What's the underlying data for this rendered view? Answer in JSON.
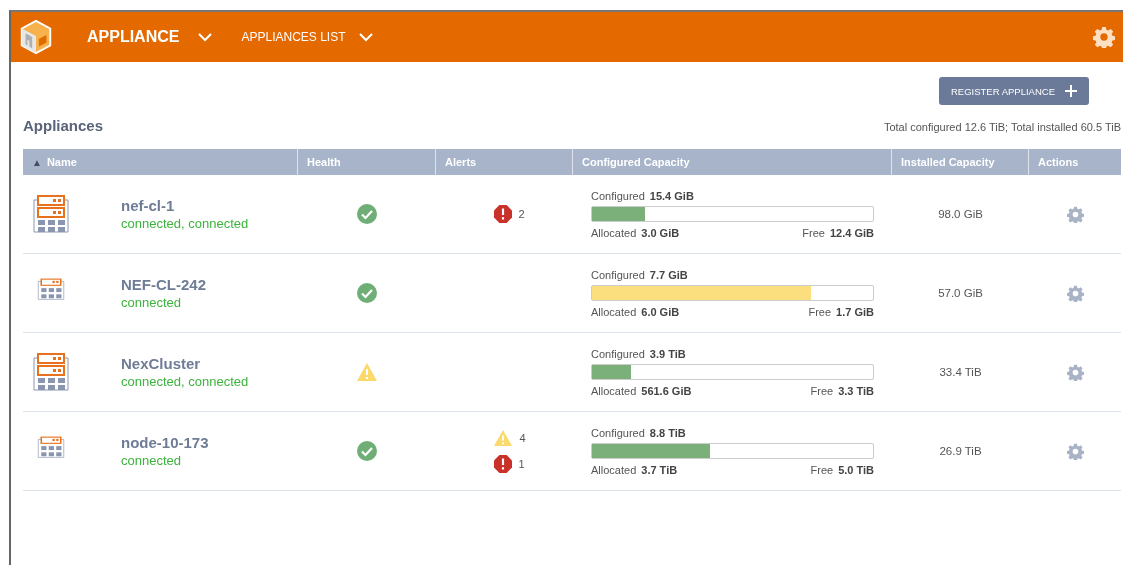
{
  "header": {
    "title": "APPLIANCE",
    "nav": "APPLIANCES LIST"
  },
  "register_button": "REGISTER APPLIANCE",
  "heading": "Appliances",
  "totals": "Total configured 12.6 TiB; Total installed 60.5 TiB",
  "table": {
    "columns": [
      {
        "label": "Name",
        "sort": "▲"
      },
      {
        "label": "Health"
      },
      {
        "label": "Alerts"
      },
      {
        "label": "Configured Capacity"
      },
      {
        "label": "Installed Capacity"
      },
      {
        "label": "Actions"
      }
    ],
    "rows": [
      {
        "kind": "cluster",
        "name": "nef-cl-1",
        "status": "connected, connected",
        "health": {
          "kind": "ok"
        },
        "alerts": [
          {
            "kind": "error",
            "count": "2"
          }
        ],
        "configured_label": "Configured",
        "configured": "15.4 GiB",
        "level": 0.19,
        "color": "#7cb07a",
        "allocated_label": "Allocated",
        "allocated": "3.0 GiB",
        "free_label": "Free",
        "free": "12.4 GiB",
        "installed": "98.0 GiB"
      },
      {
        "kind": "single",
        "name": "NEF-CL-242",
        "status": "connected",
        "health": {
          "kind": "ok"
        },
        "alerts": [],
        "configured_label": "Configured",
        "configured": "7.7 GiB",
        "level": 0.78,
        "color": "#fbdf7e",
        "allocated_label": "Allocated",
        "allocated": "6.0 GiB",
        "free_label": "Free",
        "free": "1.7 GiB",
        "installed": "57.0 GiB"
      },
      {
        "kind": "cluster",
        "name": "NexCluster",
        "status": "connected, connected",
        "health": {
          "kind": "warning"
        },
        "alerts": [],
        "configured_label": "Configured",
        "configured": "3.9 TiB",
        "level": 0.14,
        "color": "#7cb07a",
        "allocated_label": "Allocated",
        "allocated": "561.6 GiB",
        "free_label": "Free",
        "free": "3.3 TiB",
        "installed": "33.4 TiB"
      },
      {
        "kind": "single",
        "name": "node-10-173",
        "status": "connected",
        "health": {
          "kind": "ok"
        },
        "alerts": [
          {
            "kind": "warning",
            "count": "4"
          },
          {
            "kind": "error",
            "count": "1"
          }
        ],
        "configured_label": "Configured",
        "configured": "8.8 TiB",
        "level": 0.42,
        "color": "#7cb07a",
        "allocated_label": "Allocated",
        "allocated": "3.7 TiB",
        "free_label": "Free",
        "free": "5.0 TiB",
        "installed": "26.9 TiB"
      }
    ]
  }
}
